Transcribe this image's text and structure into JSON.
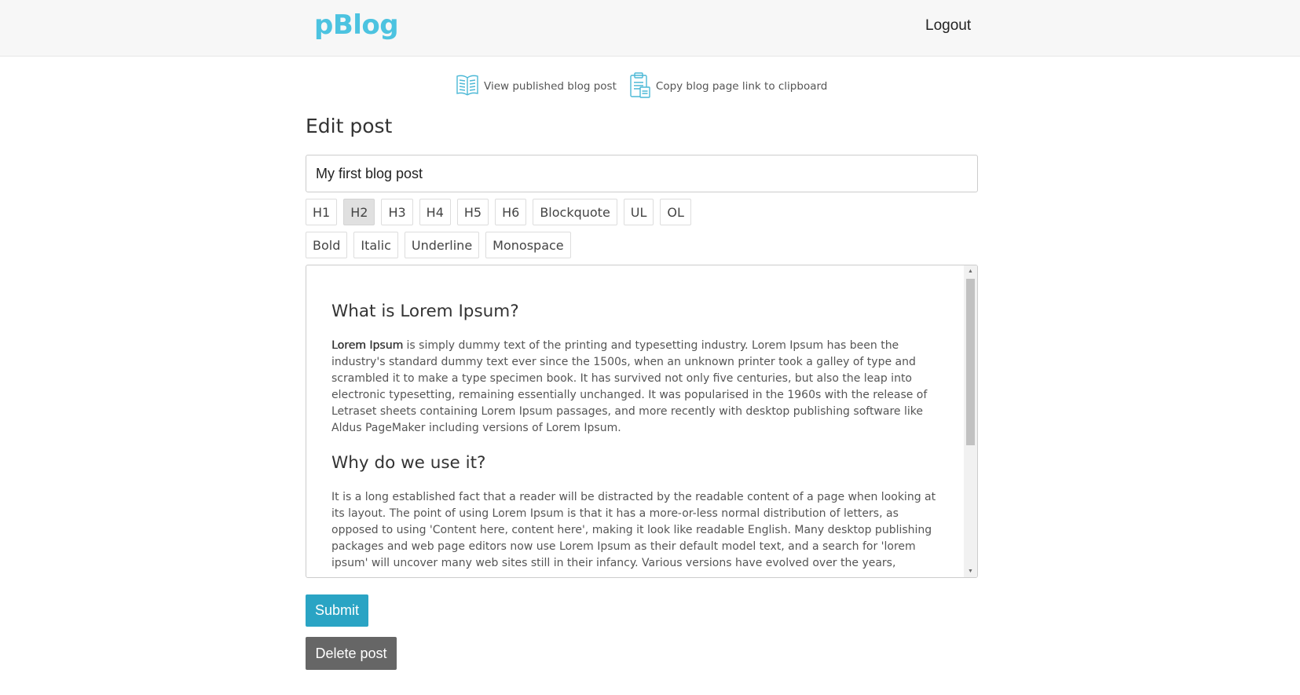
{
  "navbar": {
    "brand": "pBlog",
    "logout_label": "Logout"
  },
  "actions": {
    "view_published": {
      "label": "View published blog post",
      "icon": "open-book-icon"
    },
    "copy_link": {
      "label": "Copy blog page link to clipboard",
      "icon": "clipboard-icon"
    }
  },
  "page": {
    "title": "Edit post"
  },
  "title_input": {
    "value": "My first blog post"
  },
  "toolbar": {
    "row1": [
      "H1",
      "H2",
      "H3",
      "H4",
      "H5",
      "H6",
      "Blockquote",
      "UL",
      "OL"
    ],
    "row2": [
      "Bold",
      "Italic",
      "Underline",
      "Monospace"
    ],
    "active": "H2"
  },
  "editor": {
    "heading1": "What is Lorem Ipsum?",
    "p1_bold": "Lorem Ipsum",
    "p1_rest": " is simply dummy text of the printing and typesetting industry. Lorem Ipsum has been the industry's standard dummy text ever since the 1500s, when an unknown printer took a galley of type and scrambled it to make a type specimen book. It has survived not only five centuries, but also the leap into electronic typesetting, remaining essentially unchanged. It was popularised in the 1960s with the release of Letraset sheets containing Lorem Ipsum passages, and more recently with desktop publishing software like Aldus PageMaker including versions of Lorem Ipsum.",
    "heading2": "Why do we use it?",
    "p2": "It is a long established fact that a reader will be distracted by the readable content of a page when looking at its layout. The point of using Lorem Ipsum is that it has a more-or-less normal distribution of letters, as opposed to using 'Content here, content here', making it look like readable English. Many desktop publishing packages and web page editors now use Lorem Ipsum as their default model text, and a search for 'lorem ipsum' will uncover many web sites still in their infancy. Various versions have evolved over the years,"
  },
  "buttons": {
    "submit": "Submit",
    "delete": "Delete post"
  },
  "colors": {
    "brand": "#4cc3e0",
    "submit": "#2aa4c4",
    "delete": "#666666",
    "icon": "#4bb8d6"
  }
}
